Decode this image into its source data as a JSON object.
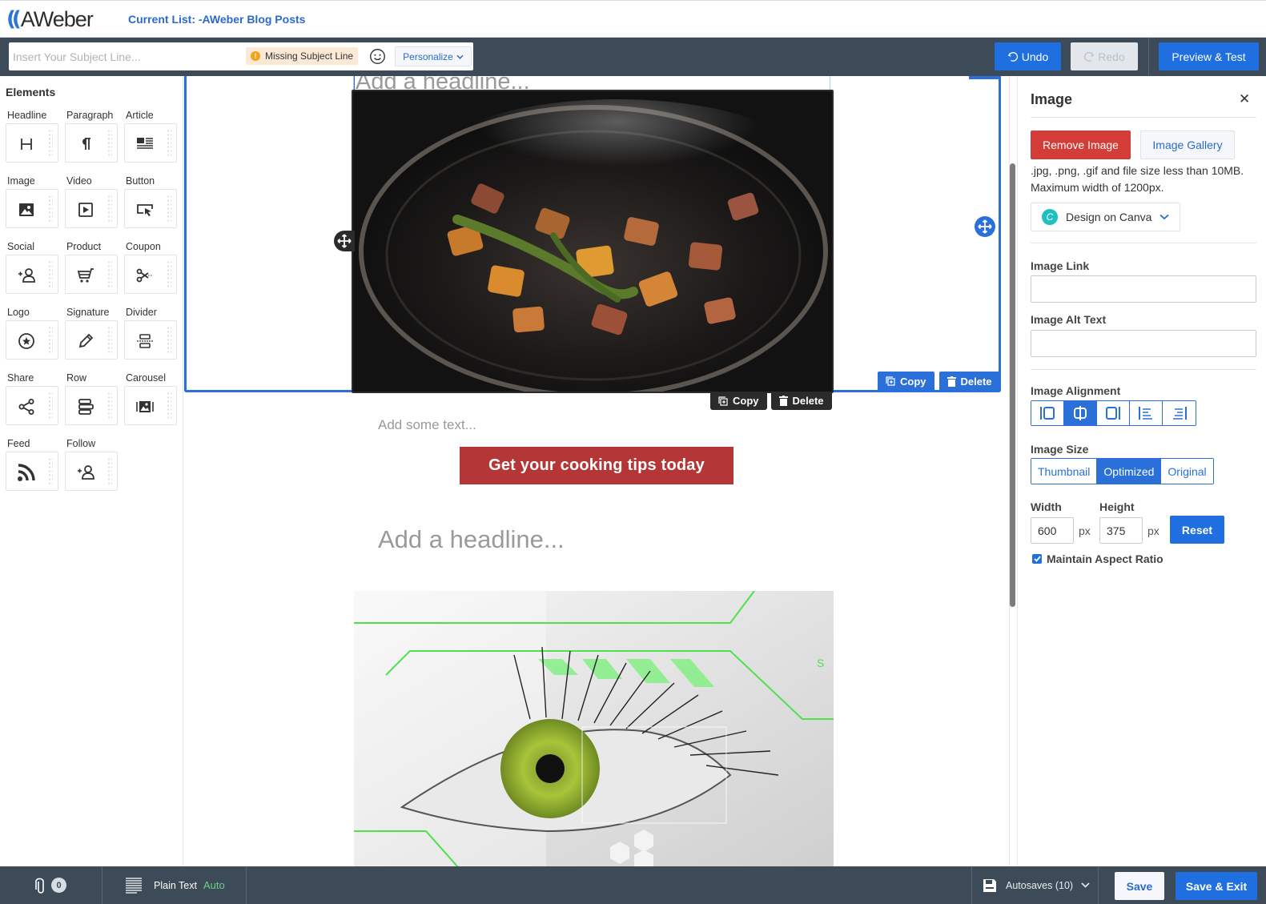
{
  "header": {
    "logo_text": "AWeber",
    "current_list": "Current List: -AWeber Blog Posts"
  },
  "toolbar": {
    "subject_placeholder": "Insert Your Subject Line...",
    "subject_value": "",
    "missing_badge": "Missing Subject Line",
    "personalize_label": "Personalize",
    "undo_label": "Undo",
    "redo_label": "Redo",
    "preview_label": "Preview & Test"
  },
  "sidebar": {
    "title": "Elements",
    "items": [
      {
        "label": "Headline",
        "icon": "headline-icon"
      },
      {
        "label": "Paragraph",
        "icon": "paragraph-icon"
      },
      {
        "label": "Article",
        "icon": "article-icon"
      },
      {
        "label": "Image",
        "icon": "image-icon"
      },
      {
        "label": "Video",
        "icon": "video-icon"
      },
      {
        "label": "Button",
        "icon": "button-icon"
      },
      {
        "label": "Social",
        "icon": "social-icon"
      },
      {
        "label": "Product",
        "icon": "cart-icon"
      },
      {
        "label": "Coupon",
        "icon": "scissors-icon"
      },
      {
        "label": "Logo",
        "icon": "logo-star-icon"
      },
      {
        "label": "Signature",
        "icon": "pencil-icon"
      },
      {
        "label": "Divider",
        "icon": "divider-icon"
      },
      {
        "label": "Share",
        "icon": "share-icon"
      },
      {
        "label": "Row",
        "icon": "row-icon"
      },
      {
        "label": "Carousel",
        "icon": "carousel-icon"
      },
      {
        "label": "Feed",
        "icon": "rss-icon"
      },
      {
        "label": "Follow",
        "icon": "follow-icon"
      }
    ]
  },
  "canvas": {
    "headline_top": "Add a headline...",
    "row_copy_label": "Copy",
    "row_delete_label": "Delete",
    "image_copy_label": "Copy",
    "image_delete_label": "Delete",
    "text_placeholder": "Add some text...",
    "cta_label": "Get your cooking tips today",
    "headline_2": "Add a headline...",
    "image_1": "food-pan-photo",
    "image_2": "green-eye-tech-photo"
  },
  "panel": {
    "title": "Image",
    "remove_label": "Remove Image",
    "gallery_label": "Image Gallery",
    "hint_line1": ".jpg, .png, .gif and file size less than 10MB.",
    "hint_line2": "Maximum width of 1200px.",
    "canva_label": "Design on Canva",
    "link_label": "Image Link",
    "link_value": "",
    "alt_label": "Image Alt Text",
    "alt_value": "",
    "alignment_label": "Image Alignment",
    "alignment_options": [
      "left-block",
      "center",
      "right-block",
      "left-wrap",
      "right-wrap"
    ],
    "alignment_selected": "center",
    "size_label": "Image Size",
    "size_options": [
      "Thumbnail",
      "Optimized",
      "Original"
    ],
    "size_selected": "Optimized",
    "width_label": "Width",
    "width_value": "600",
    "height_label": "Height",
    "height_value": "375",
    "unit": "px",
    "reset_label": "Reset",
    "aspect_label": "Maintain Aspect Ratio",
    "aspect_checked": true
  },
  "footer": {
    "attachments_count": "0",
    "plain_text_label": "Plain Text",
    "plain_text_mode": "Auto",
    "autosaves_label": "Autosaves (10)",
    "save_label": "Save",
    "save_exit_label": "Save & Exit"
  },
  "colors": {
    "primary": "#1f6fe0",
    "danger": "#d43c37",
    "toolbar_bg": "#3c4b57",
    "cta": "#b53636"
  }
}
